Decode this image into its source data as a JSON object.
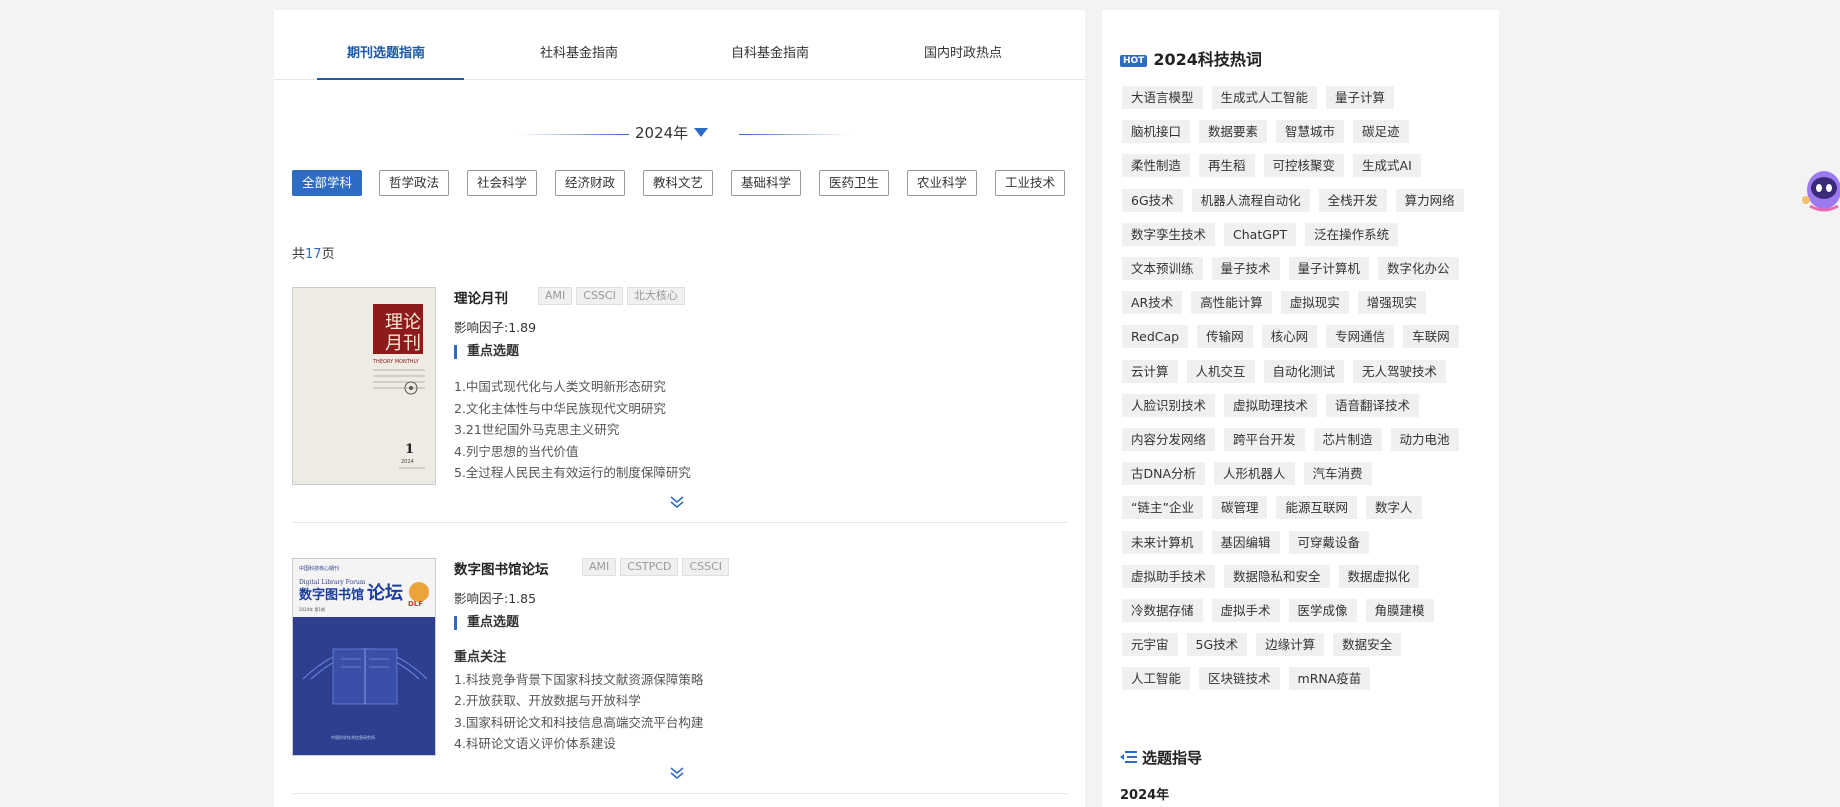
{
  "tabs": [
    {
      "label": "期刊选题指南",
      "active": true
    },
    {
      "label": "社科基金指南"
    },
    {
      "label": "自科基金指南"
    },
    {
      "label": "国内时政热点"
    }
  ],
  "year_selector": {
    "label": "2024年"
  },
  "subjects": [
    "全部学科",
    "哲学政法",
    "社会科学",
    "经济财政",
    "教科文艺",
    "基础科学",
    "医药卫生",
    "农业科学",
    "工业技术"
  ],
  "pagination": {
    "prefix": "共",
    "count": "17",
    "suffix": "页"
  },
  "journals": [
    {
      "title": "理论月刊",
      "badges": [
        "AMI",
        "CSSCI",
        "北大核心"
      ],
      "impact": "影响因子:1.89",
      "focus_label": "重点选题",
      "subhead": "",
      "topics": [
        "1.中国式现代化与人类文明新形态研究",
        "2.文化主体性与中华民族现代文明研究",
        "3.21世纪国外马克思主义研究",
        "4.列宁思想的当代价值",
        "5.全过程人民民主有效运行的制度保障研究"
      ],
      "cover": {
        "title_chars": "理论月刊",
        "subtitle": "THEORY MONTHLY",
        "issue": "1",
        "year": "2024",
        "bg": "#eeebe4",
        "accent": "#8e1b1b"
      }
    },
    {
      "title": "数字图书馆论坛",
      "badges": [
        "AMI",
        "CSTPCD",
        "CSSCI"
      ],
      "impact": "影响因子:1.85",
      "focus_label": "重点选题",
      "subhead": "重点关注",
      "topics": [
        "1.科技竞争背景下国家科技文献资源保障策略",
        "2.开放获取、开放数据与开放科学",
        "3.国家科研论文和科技信息高端交流平台构建",
        "4.科研论文语义评价体系建设"
      ],
      "cover": {
        "top_text": "中国科技核心期刊",
        "en_title": "Digital Library Forum",
        "cn_title": "数字图书馆论坛",
        "logo": "DLF",
        "bg": "#2e3f8f",
        "accent": "#e9a53a"
      }
    }
  ],
  "sidebar": {
    "hot_badge": "HOT",
    "title": "2024科技热词",
    "keywords": [
      [
        "大语言模型",
        "生成式人工智能",
        "量子计算"
      ],
      [
        "脑机接口",
        "数据要素",
        "智慧城市",
        "碳足迹"
      ],
      [
        "柔性制造",
        "再生稻",
        "可控核聚变",
        "生成式AI"
      ],
      [
        "6G技术",
        "机器人流程自动化",
        "全栈开发",
        "算力网络"
      ],
      [
        "数字孪生技术",
        "ChatGPT",
        "泛在操作系统"
      ],
      [
        "文本预训练",
        "量子技术",
        "量子计算机",
        "数字化办公"
      ],
      [
        "AR技术",
        "高性能计算",
        "虚拟现实",
        "增强现实"
      ],
      [
        "RedCap",
        "传输网",
        "核心网",
        "专网通信",
        "车联网"
      ],
      [
        "云计算",
        "人机交互",
        "自动化测试",
        "无人驾驶技术"
      ],
      [
        "人脸识别技术",
        "虚拟助理技术",
        "语音翻译技术"
      ],
      [
        "内容分发网络",
        "跨平台开发",
        "芯片制造",
        "动力电池"
      ],
      [
        "古DNA分析",
        "人形机器人",
        "汽车消费"
      ],
      [
        "“链主”企业",
        "碳管理",
        "能源互联网",
        "数字人"
      ],
      [
        "未来计算机",
        "基因编辑",
        "可穿戴设备"
      ],
      [
        "虚拟助手技术",
        "数据隐私和安全",
        "数据虚拟化"
      ],
      [
        "冷数据存储",
        "虚拟手术",
        "医学成像",
        "角膜建模"
      ],
      [
        "元宇宙",
        "5G技术",
        "边缘计算",
        "数据安全"
      ],
      [
        "人工智能",
        "区块链技术",
        "mRNA疫苗"
      ]
    ],
    "guide_title": "选题指导",
    "guide_year": "2024年"
  },
  "colors": {
    "accent": "#2d6bc4",
    "tab_active": "#1e58a8",
    "tag_bg": "#f0f0f0"
  }
}
